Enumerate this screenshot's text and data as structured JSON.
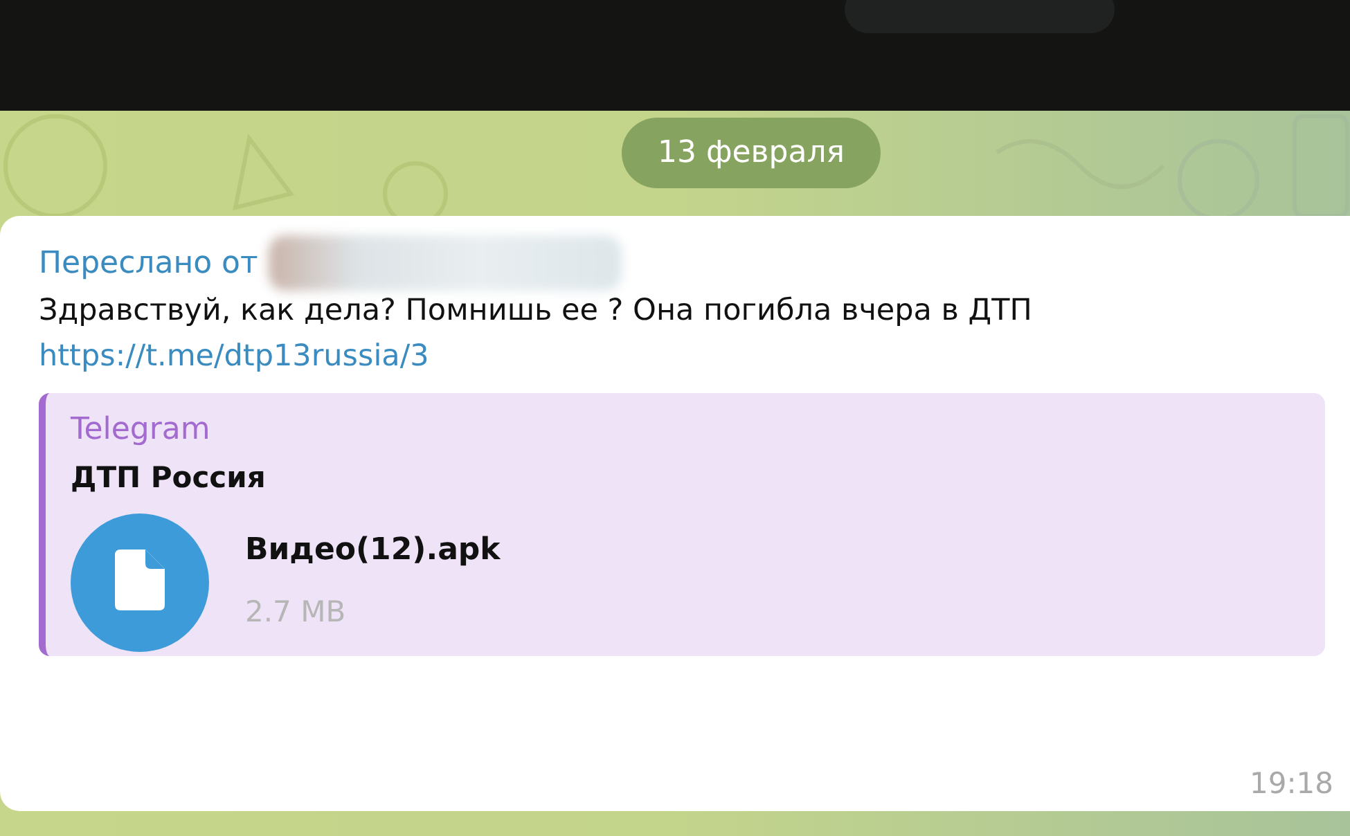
{
  "date_badge": "13 февраля",
  "message": {
    "forwarded_label": "Переслано от",
    "sender_hidden": true,
    "text": "Здравствуй, как дела? Помнишь ее ? Она погибла вчера в ДТП",
    "link": "https://t.me/dtp13russia/3",
    "preview": {
      "site": "Telegram",
      "title": "ДТП Россия",
      "file": {
        "name": "Видео(12).apk",
        "size": "2.7 MB"
      }
    },
    "time": "19:18"
  }
}
